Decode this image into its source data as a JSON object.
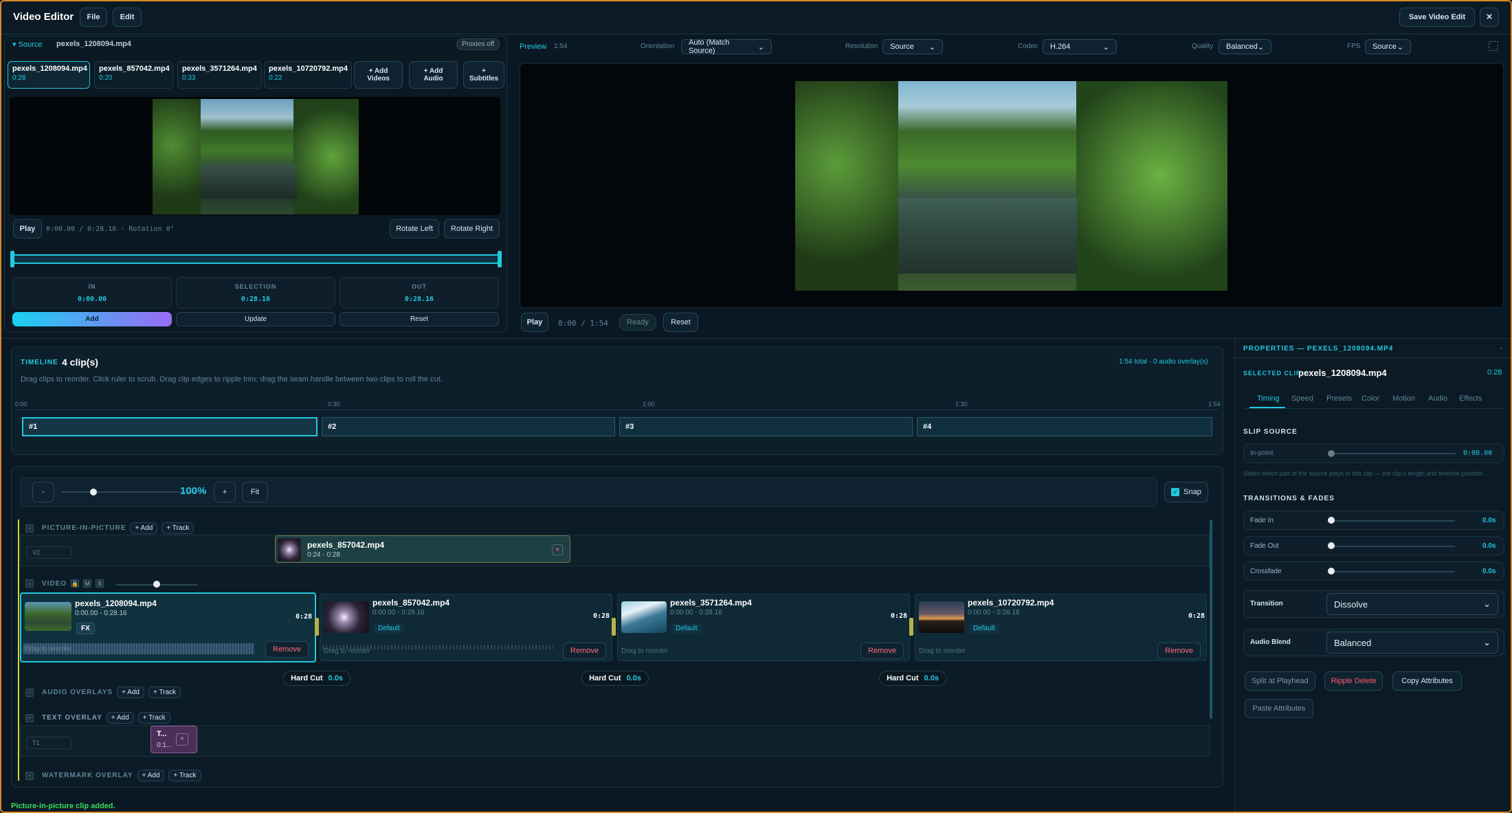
{
  "app": {
    "title": "Video Editor",
    "menu_file": "File",
    "menu_edit": "Edit",
    "save": "Save Video Edit",
    "close": "×"
  },
  "source": {
    "toggle": "▾ Source",
    "filename": "pexels_1208094.mp4",
    "proxies": "Proxies off",
    "clips": [
      {
        "name": "pexels_1208094.mp4",
        "dur": "0:28"
      },
      {
        "name": "pexels_857042.mp4",
        "dur": "0:20"
      },
      {
        "name": "pexels_3571264.mp4",
        "dur": "0:33"
      },
      {
        "name": "pexels_10720792.mp4",
        "dur": "0:22"
      }
    ],
    "add_videos": "+ Add Videos",
    "add_audio": "+ Add Audio",
    "add_subtitles": "+ Subtitles",
    "play": "Play",
    "timecode": "0:00.00 / 0:28.16 · Rotation 0°",
    "rotate_left": "Rotate Left",
    "rotate_right": "Rotate Right",
    "in_label": "IN",
    "in_value": "0:00.00",
    "sel_label": "SELECTION",
    "sel_value": "0:28.16",
    "out_label": "OUT",
    "out_value": "0:28.16",
    "add": "Add",
    "update": "Update",
    "reset": "Reset"
  },
  "preview": {
    "label": "Preview",
    "duration": "1:54",
    "orientation_label": "Orientation",
    "orientation": "Auto (Match Source)",
    "resolution_label": "Resolution",
    "resolution": "Source",
    "codec_label": "Codec",
    "codec": "H.264",
    "quality_label": "Quality",
    "quality": "Balanced",
    "fps_label": "FPS",
    "fps": "Source",
    "play": "Play",
    "timecode": "0:00 / 1:54",
    "status": "Ready",
    "reset": "Reset"
  },
  "timeline": {
    "label": "TIMELINE",
    "count": "4 clip(s)",
    "summary": "1:54 total · 0 audio overlay(s)",
    "hint": "Drag clips to reorder. Click ruler to scrub. Drag clip edges to ripple trim; drag the seam handle between two clips to roll the cut.",
    "ruler": [
      "0:00",
      "0:30",
      "1:00",
      "1:30",
      "1:54"
    ],
    "blocks": [
      "#1",
      "#2",
      "#3",
      "#4"
    ]
  },
  "editor": {
    "minus": "-",
    "zoom": "100%",
    "plus": "+",
    "fit": "Fit",
    "snap": "Snap",
    "pip": {
      "label": "PICTURE-IN-PICTURE",
      "add": "+ Add",
      "track": "+ Track",
      "lane": "V2",
      "clip_name": "pexels_857042.mp4",
      "clip_time": "0:24 - 0:28",
      "remove": "×"
    },
    "video": {
      "label": "VIDEO",
      "m": "M",
      "s": "S",
      "clips": [
        {
          "name": "pexels_1208094.mp4",
          "range": "0:00.00 - 0:28.16",
          "dur": "0:28",
          "tag": "FX",
          "drag": "Drag to reorder",
          "remove": "Remove"
        },
        {
          "name": "pexels_857042.mp4",
          "range": "0:00.00 - 0:28.16",
          "dur": "0:28",
          "tag": "Default",
          "drag": "Drag to reorder",
          "remove": "Remove"
        },
        {
          "name": "pexels_3571264.mp4",
          "range": "0:00.00 - 0:28.16",
          "dur": "0:28",
          "tag": "Default",
          "drag": "Drag to reorder",
          "remove": "Remove"
        },
        {
          "name": "pexels_10720792.mp4",
          "range": "0:00.00 - 0:28.16",
          "dur": "0:28",
          "tag": "Default",
          "drag": "Drag to reorder",
          "remove": "Remove"
        }
      ],
      "cuts": [
        {
          "label": "Hard Cut",
          "val": "0.0s"
        },
        {
          "label": "Hard Cut",
          "val": "0.0s"
        },
        {
          "label": "Hard Cut",
          "val": "0.0s"
        }
      ]
    },
    "audio_overlays": {
      "label": "AUDIO OVERLAYS",
      "add": "+ Add",
      "track": "+ Track"
    },
    "text_overlay": {
      "label": "TEXT OVERLAY",
      "add": "+ Add",
      "track": "+ Track",
      "lane": "T1",
      "clip_title": "T...",
      "clip_time": "0:1...",
      "remove": "×"
    },
    "watermark": {
      "label": "WATERMARK OVERLAY",
      "add": "+ Add",
      "track": "+ Track"
    }
  },
  "properties": {
    "title": "PROPERTIES — PEXELS_1208094.MP4",
    "collapse": "-",
    "selected_label": "SELECTED CLIP",
    "selected_name": "pexels_1208094.mp4",
    "selected_dur": "0:28",
    "tabs": [
      "Timing",
      "Speed",
      "Presets",
      "Color",
      "Motion",
      "Audio",
      "Effects"
    ],
    "slip": "SLIP SOURCE",
    "inpoint_label": "In-point",
    "inpoint_value": "0:00.00",
    "slip_hint": "Slides which part of the source plays in this clip — the clip's length and timeline position ...",
    "transitions": "TRANSITIONS & FADES",
    "fade_in": "Fade In",
    "fade_in_v": "0.0s",
    "fade_out": "Fade Out",
    "fade_out_v": "0.0s",
    "crossfade": "Crossfade",
    "crossfade_v": "0.0s",
    "transition_label": "Transition",
    "transition": "Dissolve",
    "blend_label": "Audio Blend",
    "blend": "Balanced",
    "split": "Split at Playhead",
    "ripple": "Ripple Delete",
    "copy": "Copy Attributes",
    "paste": "Paste Attributes"
  },
  "status": "Picture-in-picture clip added.",
  "colors": {
    "accent": "#22c9e0",
    "bg": "#0a1824",
    "border_top": "#e08a1a",
    "status": "#3ddc5c",
    "danger": "#ff5a6e"
  }
}
